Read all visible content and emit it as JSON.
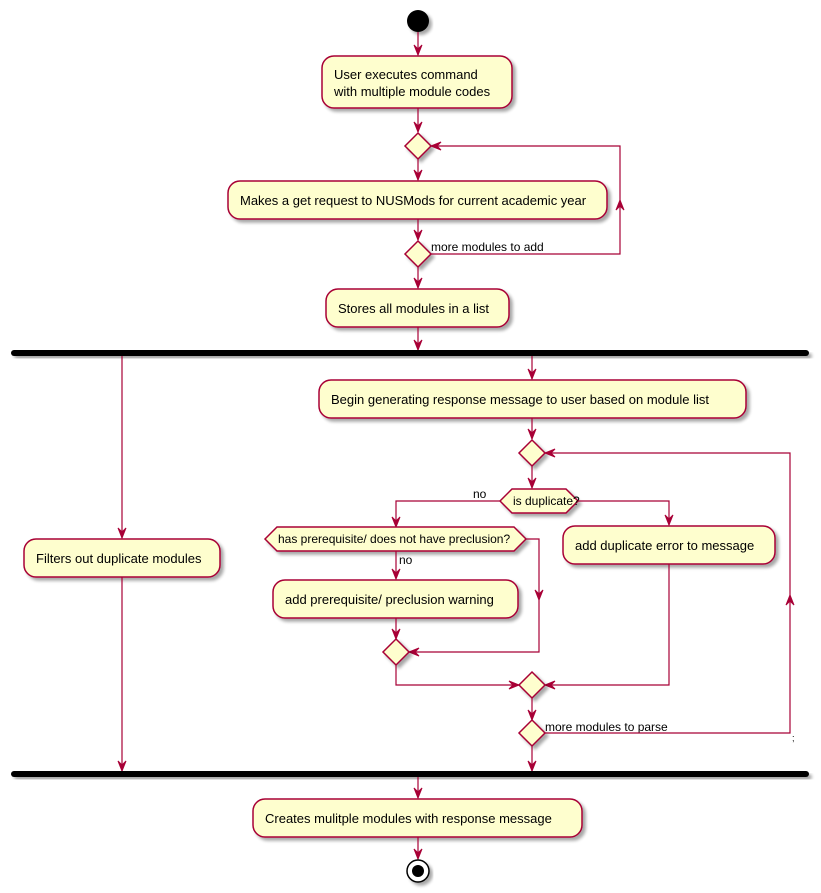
{
  "diagram": {
    "type": "uml-activity",
    "colors": {
      "activity_fill": "#FEFECE",
      "border": "#A80036",
      "fork_bar": "#000000",
      "start_node": "#000000"
    },
    "start": {
      "label": "start"
    },
    "stop": {
      "label": "stop"
    },
    "activities": {
      "user_executes": [
        "User executes command",
        "with multiple module codes"
      ],
      "get_request": "Makes a get request to NUSMods for current academic year",
      "stores_modules": "Stores all modules in a list",
      "filters_duplicates": "Filters out duplicate modules",
      "begin_generating": "Begin generating response message to user based on module list",
      "add_duplicate_error": "add duplicate error to message",
      "add_prereq_warning": "add prerequisite/ preclusion warning",
      "creates_modules": "Creates mulitple modules with response message"
    },
    "decisions": {
      "is_duplicate": "is duplicate?",
      "has_prereq": "has prerequisite/ does not have preclusion?"
    },
    "edge_labels": {
      "more_to_add": "more modules to add",
      "more_to_parse": "more modules to parse",
      "is_duplicate_no": "no",
      "has_prereq_no": "no",
      "stray_mark": ";"
    }
  }
}
